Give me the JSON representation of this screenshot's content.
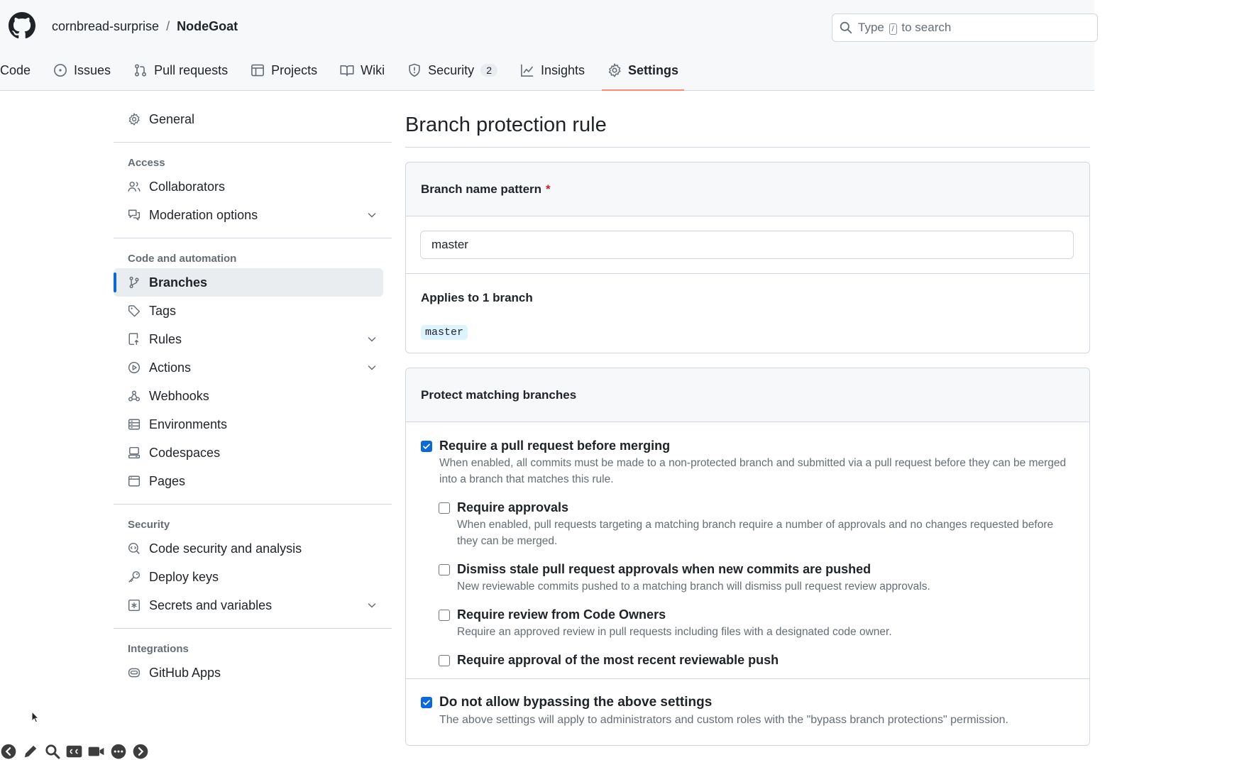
{
  "header": {
    "owner": "cornbread-surprise",
    "separator": "/",
    "repo": "NodeGoat",
    "search": {
      "prefix": "Type",
      "key": "/",
      "suffix": "to search"
    }
  },
  "tabs": [
    {
      "label": "Code",
      "icon": "code-icon"
    },
    {
      "label": "Issues",
      "icon": "issue-icon"
    },
    {
      "label": "Pull requests",
      "icon": "pull-request-icon"
    },
    {
      "label": "Projects",
      "icon": "table-icon"
    },
    {
      "label": "Wiki",
      "icon": "book-icon"
    },
    {
      "label": "Security",
      "icon": "shield-icon",
      "counter": "2"
    },
    {
      "label": "Insights",
      "icon": "graph-icon"
    },
    {
      "label": "Settings",
      "icon": "gear-icon",
      "active": true
    }
  ],
  "sidebar": {
    "general": "General",
    "access_title": "Access",
    "access": [
      "Collaborators",
      "Moderation options"
    ],
    "code_title": "Code and automation",
    "code": [
      "Branches",
      "Tags",
      "Rules",
      "Actions",
      "Webhooks",
      "Environments",
      "Codespaces",
      "Pages"
    ],
    "security_title": "Security",
    "security": [
      "Code security and analysis",
      "Deploy keys",
      "Secrets and variables"
    ],
    "integrations_title": "Integrations",
    "integrations": [
      "GitHub Apps"
    ]
  },
  "main": {
    "title": "Branch protection rule",
    "pattern_label": "Branch name pattern",
    "required_mark": "*",
    "pattern_value": "master",
    "applies_title": "Applies to 1 branch",
    "matched_branch": "master",
    "protect_title": "Protect matching branches",
    "rules": [
      {
        "title": "Require a pull request before merging",
        "desc": "When enabled, all commits must be made to a non-protected branch and submitted via a pull request before they can be merged into a branch that matches this rule.",
        "checked": true
      },
      {
        "title": "Require approvals",
        "desc": "When enabled, pull requests targeting a matching branch require a number of approvals and no changes requested before they can be merged.",
        "checked": false
      },
      {
        "title": "Dismiss stale pull request approvals when new commits are pushed",
        "desc": "New reviewable commits pushed to a matching branch will dismiss pull request review approvals.",
        "checked": false
      },
      {
        "title": "Require review from Code Owners",
        "desc": "Require an approved review in pull requests including files with a designated code owner.",
        "checked": false
      },
      {
        "title": "Require approval of the most recent reviewable push",
        "desc": "",
        "checked": false
      }
    ],
    "bypass": {
      "title": "Do not allow bypassing the above settings",
      "desc": "The above settings will apply to administrators and custom roles with the \"bypass branch protections\" permission.",
      "checked": true
    }
  },
  "colors": {
    "accent": "#0969da",
    "tab_underline": "#fd8c73",
    "required": "#cf222e",
    "branch_pill_bg": "#ddf4ff"
  }
}
